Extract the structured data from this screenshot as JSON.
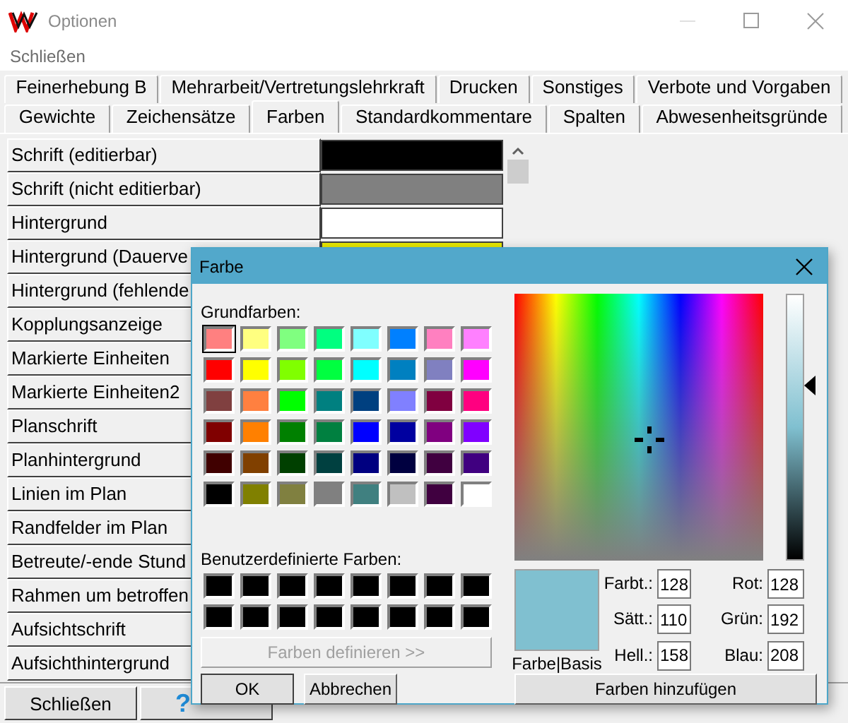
{
  "window": {
    "title": "Optionen",
    "menu": [
      "Schließen"
    ]
  },
  "tab_rows": [
    [
      {
        "label": "Feinerhebung B",
        "selected": false
      },
      {
        "label": "Mehrarbeit/Vertretungslehrkraft",
        "selected": false
      },
      {
        "label": "Drucken",
        "selected": false
      },
      {
        "label": "Sonstiges",
        "selected": false
      },
      {
        "label": "Verbote und Vorgaben",
        "selected": false
      }
    ],
    [
      {
        "label": "Gewichte",
        "selected": false
      },
      {
        "label": "Zeichensätze",
        "selected": false
      },
      {
        "label": "Farben",
        "selected": true
      },
      {
        "label": "Standardkommentare",
        "selected": false
      },
      {
        "label": "Spalten",
        "selected": false
      },
      {
        "label": "Abwesenheitsgründe",
        "selected": false
      }
    ]
  ],
  "color_rows": [
    {
      "label": "Schrift (editierbar)",
      "color": "#000000"
    },
    {
      "label": "Schrift (nicht editierbar)",
      "color": "#808080"
    },
    {
      "label": "Hintergrund",
      "color": "#ffffff"
    },
    {
      "label": "Hintergrund (Dauerve",
      "color": "#e8e800"
    },
    {
      "label": "Hintergrund (fehlende"
    },
    {
      "label": "Kopplungsanzeige"
    },
    {
      "label": "Markierte Einheiten"
    },
    {
      "label": "Markierte Einheiten2"
    },
    {
      "label": "Planschrift"
    },
    {
      "label": "Planhintergrund"
    },
    {
      "label": "Linien im Plan"
    },
    {
      "label": "Randfelder im Plan"
    },
    {
      "label": "Betreute/-ende Stund"
    },
    {
      "label": "Rahmen um betroffen"
    },
    {
      "label": "Aufsichtschrift"
    },
    {
      "label": "Aufsichthintergrund"
    }
  ],
  "buttons": [
    {
      "kind": "text",
      "label": "Schließen"
    },
    {
      "kind": "help",
      "label": "?"
    }
  ],
  "dialog": {
    "title": "Farbe",
    "basic_label": "Grundfarben:",
    "basic_colors": [
      {
        "color": "#ff8080",
        "selected": true
      },
      {
        "color": "#ffff80",
        "selected": false
      },
      {
        "color": "#80ff80",
        "selected": false
      },
      {
        "color": "#00ff80",
        "selected": false
      },
      {
        "color": "#80ffff",
        "selected": false
      },
      {
        "color": "#0080ff",
        "selected": false
      },
      {
        "color": "#ff80c0",
        "selected": false
      },
      {
        "color": "#ff80ff",
        "selected": false
      },
      {
        "color": "#ff0000",
        "selected": false
      },
      {
        "color": "#ffff00",
        "selected": false
      },
      {
        "color": "#80ff00",
        "selected": false
      },
      {
        "color": "#00ff40",
        "selected": false
      },
      {
        "color": "#00ffff",
        "selected": false
      },
      {
        "color": "#0080c0",
        "selected": false
      },
      {
        "color": "#8080c0",
        "selected": false
      },
      {
        "color": "#ff00ff",
        "selected": false
      },
      {
        "color": "#804040",
        "selected": false
      },
      {
        "color": "#ff8040",
        "selected": false
      },
      {
        "color": "#00ff00",
        "selected": false
      },
      {
        "color": "#008080",
        "selected": false
      },
      {
        "color": "#004080",
        "selected": false
      },
      {
        "color": "#8080ff",
        "selected": false
      },
      {
        "color": "#800040",
        "selected": false
      },
      {
        "color": "#ff0080",
        "selected": false
      },
      {
        "color": "#800000",
        "selected": false
      },
      {
        "color": "#ff8000",
        "selected": false
      },
      {
        "color": "#008000",
        "selected": false
      },
      {
        "color": "#008040",
        "selected": false
      },
      {
        "color": "#0000ff",
        "selected": false
      },
      {
        "color": "#0000a0",
        "selected": false
      },
      {
        "color": "#800080",
        "selected": false
      },
      {
        "color": "#8000ff",
        "selected": false
      },
      {
        "color": "#400000",
        "selected": false
      },
      {
        "color": "#804000",
        "selected": false
      },
      {
        "color": "#004000",
        "selected": false
      },
      {
        "color": "#004040",
        "selected": false
      },
      {
        "color": "#000080",
        "selected": false
      },
      {
        "color": "#000040",
        "selected": false
      },
      {
        "color": "#400040",
        "selected": false
      },
      {
        "color": "#400080",
        "selected": false
      },
      {
        "color": "#000000",
        "selected": false
      },
      {
        "color": "#808000",
        "selected": false
      },
      {
        "color": "#808040",
        "selected": false
      },
      {
        "color": "#808080",
        "selected": false
      },
      {
        "color": "#408080",
        "selected": false
      },
      {
        "color": "#c0c0c0",
        "selected": false
      },
      {
        "color": "#400040",
        "selected": false
      },
      {
        "color": "#ffffff",
        "selected": false
      }
    ],
    "custom_label": "Benutzerdefinierte Farben:",
    "custom_colors": [
      {
        "color": "#000000"
      },
      {
        "color": "#000000"
      },
      {
        "color": "#000000"
      },
      {
        "color": "#000000"
      },
      {
        "color": "#000000"
      },
      {
        "color": "#000000"
      },
      {
        "color": "#000000"
      },
      {
        "color": "#000000"
      },
      {
        "color": "#000000"
      },
      {
        "color": "#000000"
      },
      {
        "color": "#000000"
      },
      {
        "color": "#000000"
      },
      {
        "color": "#000000"
      },
      {
        "color": "#000000"
      },
      {
        "color": "#000000"
      },
      {
        "color": "#000000"
      }
    ],
    "define_button": {
      "label": "Farben definieren >>",
      "disabled": true
    },
    "ok": "OK",
    "cancel": "Abbrechen",
    "luminance": {
      "level": 0.66
    },
    "preview": {
      "color": "#80c0d0",
      "label": "Farbe|Basis"
    },
    "fields": [
      {
        "label": "Farbt.:",
        "value": "128"
      },
      {
        "label": "Rot:",
        "value": "128"
      },
      {
        "label": "Sätt.:",
        "value": "110"
      },
      {
        "label": "Grün:",
        "value": "192"
      },
      {
        "label": "Hell.:",
        "value": "158"
      },
      {
        "label": "Blau:",
        "value": "208"
      }
    ],
    "add_button": "Farben hinzufügen"
  }
}
